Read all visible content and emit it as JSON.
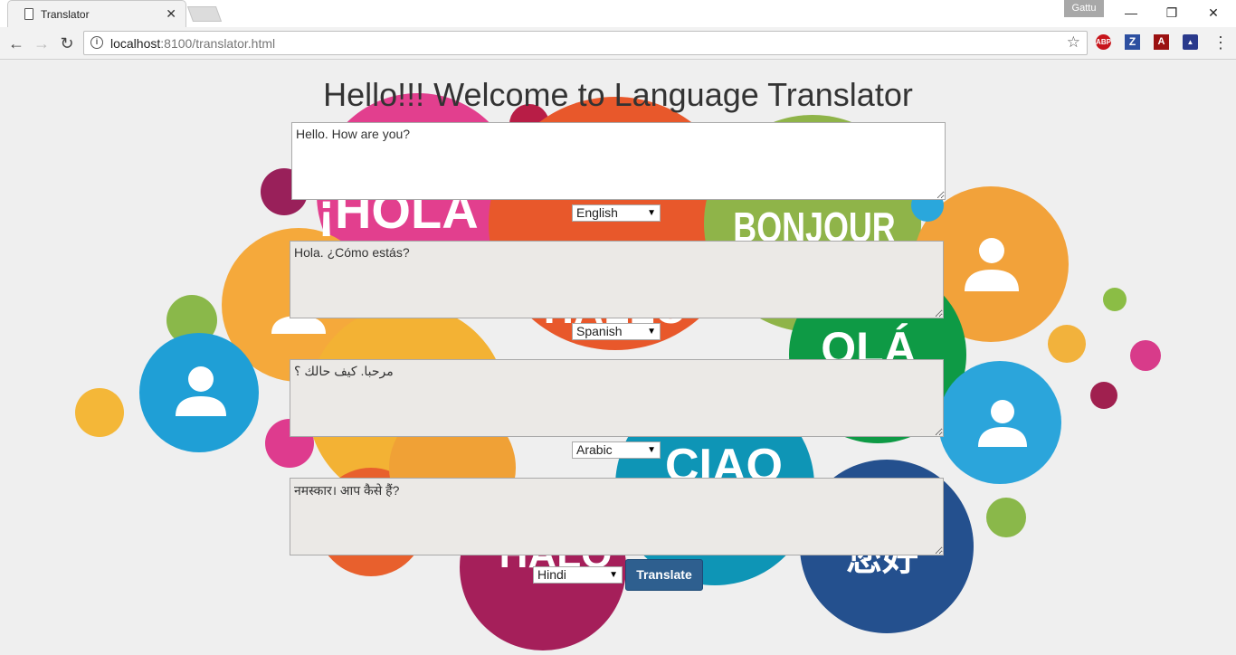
{
  "browser": {
    "tab_title": "Translator",
    "profile_name": "Gattu",
    "url_host": "localhost",
    "url_path": ":8100/translator.html",
    "extensions": {
      "abp": "ABP",
      "z": "Z",
      "pdf": "A",
      "doc": "▲"
    }
  },
  "page": {
    "title": "Hello!!! Welcome to Language Translator",
    "background_words": [
      "¡HOLA",
      "BONJOUR",
      "HALLO",
      "OLÁ",
      "CIAO",
      "HALO",
      "您好"
    ],
    "translate_label": "Translate",
    "fields": [
      {
        "text": "Hello. How are you?",
        "language": "English"
      },
      {
        "text": "Hola. ¿Cómo estás?",
        "language": "Spanish"
      },
      {
        "text": "مرحبا. كيف حالك ؟",
        "language": "Arabic"
      },
      {
        "text": "नमस्कार। आप कैसे हैं?",
        "language": "Hindi"
      }
    ]
  },
  "colors": {
    "accent_button": "#2e5f8f",
    "output_field_bg": "#ebe9e6"
  }
}
